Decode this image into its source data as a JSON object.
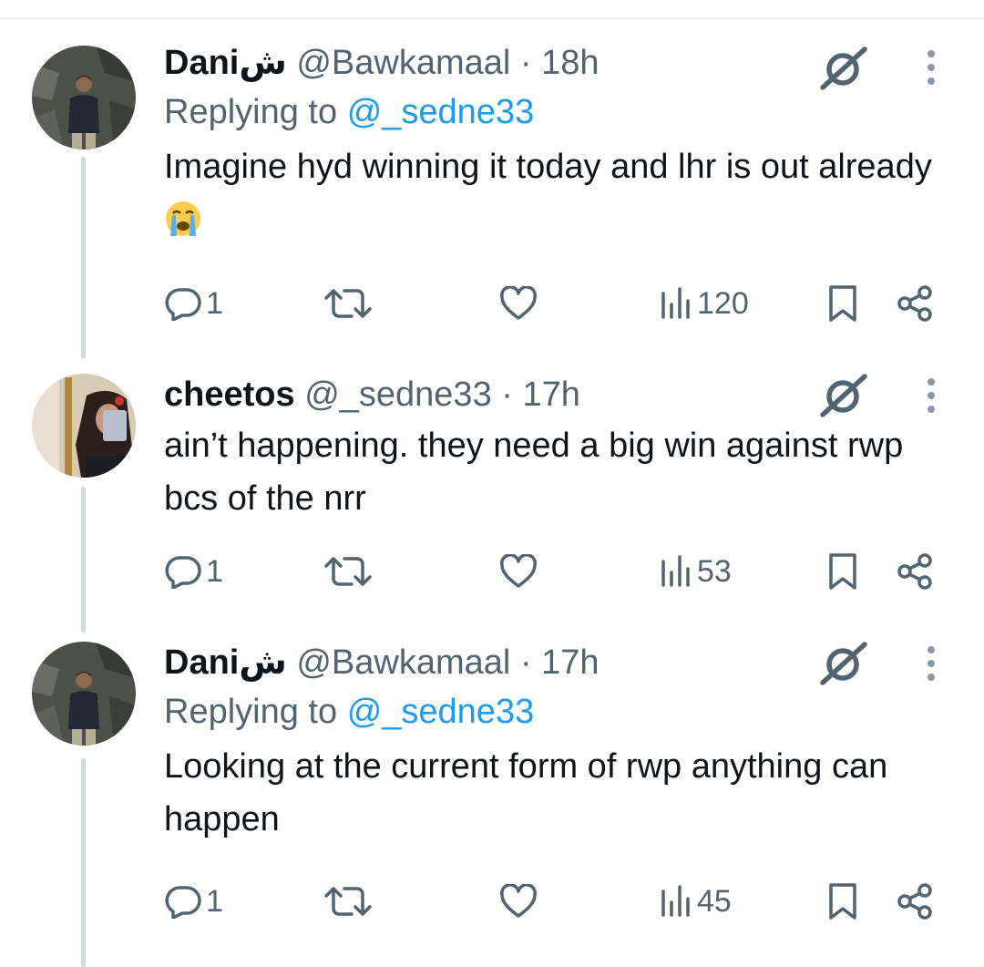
{
  "tweets": [
    {
      "display_name": "Daniش",
      "handle": "@Bawkamaal",
      "separator": "·",
      "time": "18h",
      "replying_label": "Replying to",
      "replying_to": "@_sedne33",
      "text": "Imagine hyd winning it today and lhr is out already",
      "emoji": "crying-face",
      "replies": "1",
      "views": "120"
    },
    {
      "display_name": "cheetos",
      "handle": "@_sedne33",
      "separator": "·",
      "time": "17h",
      "text": "ain’t happening. they need a big win against rwp bcs of the nrr",
      "replies": "1",
      "views": "53"
    },
    {
      "display_name": "Daniش",
      "handle": "@Bawkamaal",
      "separator": "·",
      "time": "17h",
      "replying_label": "Replying to",
      "replying_to": "@_sedne33",
      "text": "Looking at the current form of rwp anything can happen",
      "replies": "1",
      "views": "45"
    }
  ],
  "icons": [
    "reply-icon",
    "retweet-icon",
    "like-icon",
    "views-icon",
    "bookmark-icon",
    "share-icon",
    "grok-icon",
    "more-icon"
  ],
  "colors": {
    "text": "#0f1419",
    "secondary": "#536471",
    "link": "#1d9bf0",
    "thread_line": "#cfd9de"
  }
}
